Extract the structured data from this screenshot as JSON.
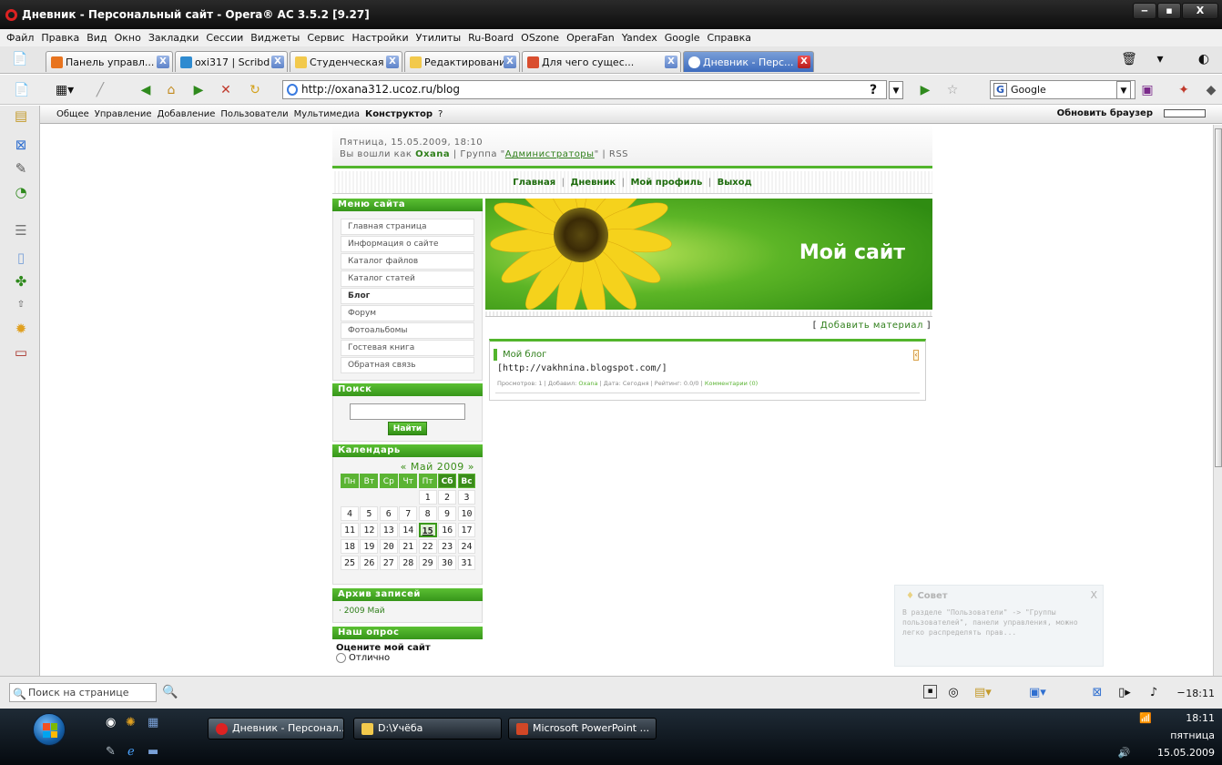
{
  "window": {
    "title": "Дневник - Персональный сайт - Opera® AC 3.5.2 [9.27]",
    "minimize": "‒",
    "maximize": "▪",
    "close": "X"
  },
  "menu": [
    "Файл",
    "Правка",
    "Вид",
    "Окно",
    "Закладки",
    "Сессии",
    "Виджеты",
    "Сервис",
    "Настройки",
    "Утилиты",
    "Ru-Board",
    "OSzone",
    "OperaFan",
    "Yandex",
    "Google",
    "Справка"
  ],
  "tabs": [
    {
      "label": "Панель управл...",
      "icon_color": "#e8741f"
    },
    {
      "label": "oxi317 | Scribd",
      "icon_color": "#2f8bd0"
    },
    {
      "label": "Студенческая ...",
      "icon_color": "#f2c94c"
    },
    {
      "label": "Редактировани...",
      "icon_color": "#f2c94c"
    },
    {
      "label": "Для чего сущес...",
      "icon_color": "#d94e2f"
    },
    {
      "label": "Дневник - Перс...",
      "icon_color": "#2a6fd6"
    }
  ],
  "tab_close_glyph": "X",
  "address": {
    "url": "http://oxana312.ucoz.ru/blog",
    "search_engine": "Google",
    "help_glyph": "?"
  },
  "adminbar": {
    "items": [
      "Общее",
      "Управление",
      "Добавление",
      "Пользователи",
      "Мультимедиа"
    ],
    "bold_item": "Конструктор",
    "help": "?",
    "refresh": "Обновить браузер"
  },
  "site": {
    "date": "Пятница, 15.05.2009, 18:10",
    "login_prefix": "Вы вошли как",
    "user": "Oxana",
    "group_prefix": "| Группа \"",
    "group": "Администраторы",
    "group_suffix": "\" | RSS",
    "nav": [
      "Главная",
      "Дневник",
      "Мой профиль",
      "Выход"
    ],
    "nav_sep": "|",
    "banner_title": "Мой сайт",
    "add_open": "[",
    "add_material": "Добавить материал",
    "add_close": "]"
  },
  "menu_block": {
    "title": "Меню сайта",
    "items": [
      "Главная страница",
      "Информация о сайте",
      "Каталог файлов",
      "Каталог статей",
      "Блог",
      "Форум",
      "Фотоальбомы",
      "Гостевая книга",
      "Обратная связь"
    ],
    "active_index": 4
  },
  "search_block": {
    "title": "Поиск",
    "button": "Найти"
  },
  "calendar": {
    "title": "Календарь",
    "month": "« Май 2009 »",
    "headers": [
      "Пн",
      "Вт",
      "Ср",
      "Чт",
      "Пт",
      "Сб",
      "Вс"
    ],
    "weeks": [
      [
        "",
        "",
        "",
        "",
        "1",
        "2",
        "3"
      ],
      [
        "4",
        "5",
        "6",
        "7",
        "8",
        "9",
        "10"
      ],
      [
        "11",
        "12",
        "13",
        "14",
        "15",
        "16",
        "17"
      ],
      [
        "18",
        "19",
        "20",
        "21",
        "22",
        "23",
        "24"
      ],
      [
        "25",
        "26",
        "27",
        "28",
        "29",
        "30",
        "31"
      ]
    ],
    "today": "15"
  },
  "archive": {
    "title": "Архив записей",
    "item": "2009 Май"
  },
  "poll": {
    "title": "Наш опрос",
    "question": "Оцените мой сайт",
    "option": "Отлично"
  },
  "entry": {
    "title": "Мой блог",
    "edit_glyph": "‹",
    "link": "[http://vakhnina.blogspot.com/]",
    "meta_views": "Просмотров: 1 | Добавил:",
    "meta_user": "Oxana",
    "meta_date": "| Дата: Сегодня | Рейтинг: 0.0/0 |",
    "meta_comments": "Комментарии (0)"
  },
  "tip": {
    "title": "Совет",
    "close": "X",
    "text": "В разделе \"Пользователи\" -> \"Группы пользователей\", панели управления, можно легко распределять прав..."
  },
  "statusbar": {
    "find_placeholder": "Поиск на странице",
    "time": "18:11"
  },
  "taskbar": {
    "tasks": [
      {
        "label": "Дневник - Персонал...",
        "icon_color": "#d22"
      },
      {
        "label": "D:\\Учёба",
        "icon_color": "#f2c94c"
      },
      {
        "label": "Microsoft PowerPoint ...",
        "icon_color": "#d24726"
      }
    ],
    "clock_time": "18:11",
    "day": "пятница",
    "date": "15.05.2009"
  },
  "colors": {
    "accent_green": "#52b52c",
    "active_tab": "#3d6bbd"
  }
}
